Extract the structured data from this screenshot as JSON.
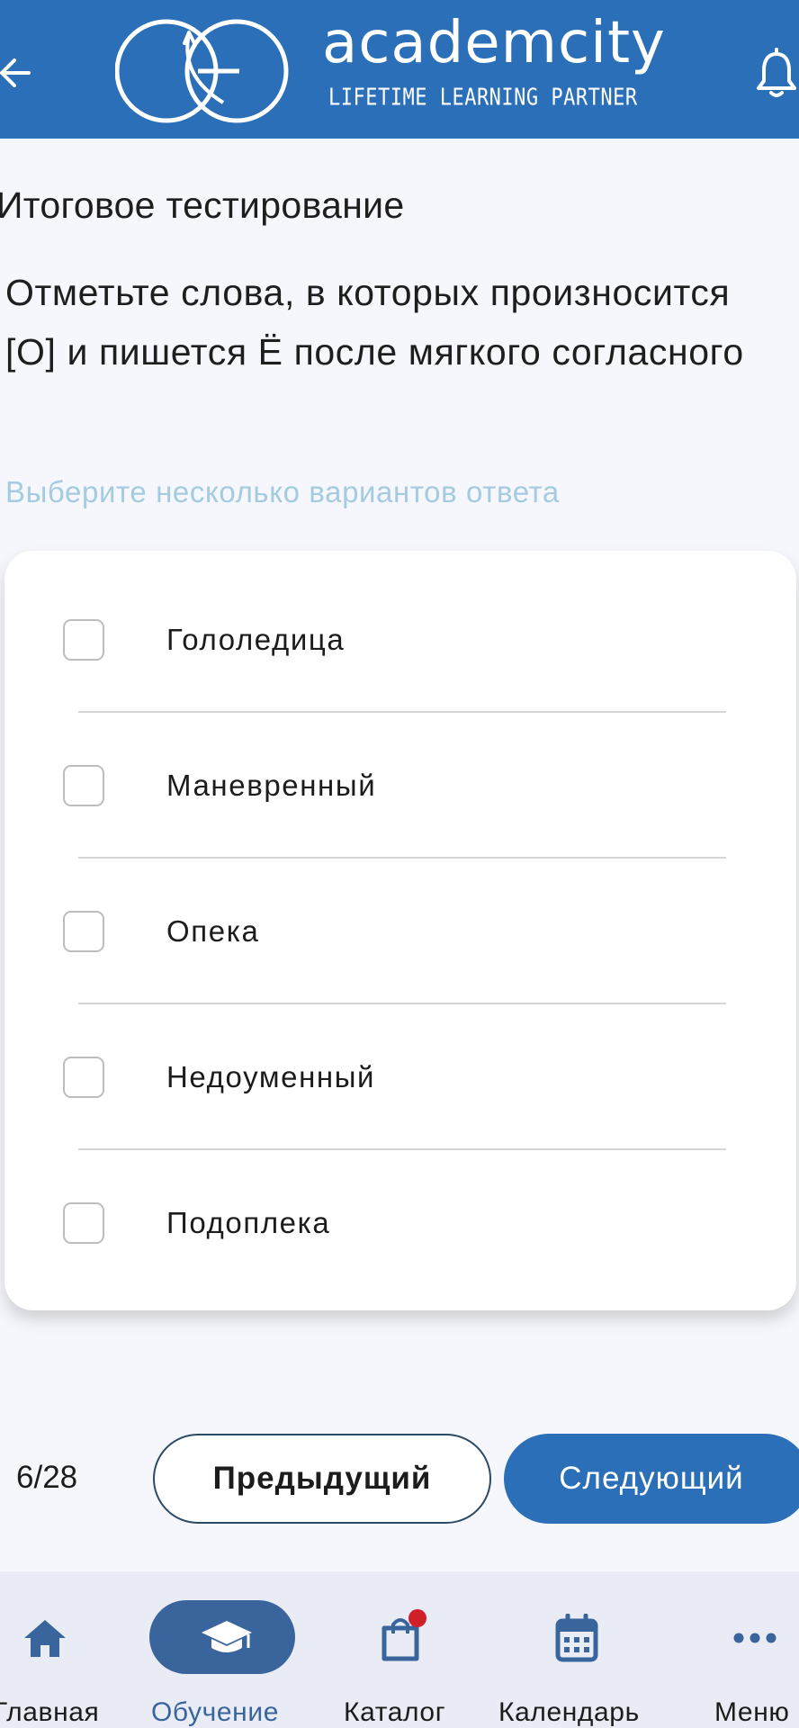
{
  "header": {
    "brand": "academcity",
    "tagline": "LIFETIME LEARNING PARTNER",
    "color": "#2a6fb7"
  },
  "test": {
    "title": "Итоговое тестирование",
    "question": "Отметьте слова, в которых произносится [О] и пишется Ё после мягкого согласного",
    "hint": "Выберите несколько вариантов ответа",
    "options": [
      "Гололедица",
      "Маневренный",
      "Опека",
      "Недоуменный",
      "Подоплека"
    ]
  },
  "pagination": {
    "counter": "6/28",
    "prev_label": "Предыдущий",
    "next_label": "Следующий"
  },
  "nav": {
    "home": "Главная",
    "learning": "Обучение",
    "catalog": "Каталог",
    "calendar": "Календарь",
    "menu": "Меню",
    "active_color": "#3a659c",
    "badge_color": "#d11f2a"
  }
}
